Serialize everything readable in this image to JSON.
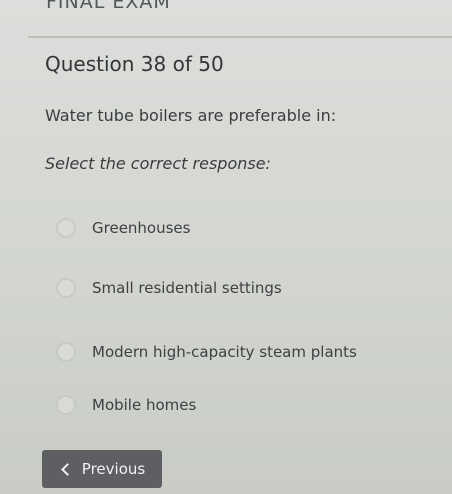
{
  "header": {
    "title": "FINAL EXAM"
  },
  "question": {
    "number_label": "Question 38 of 50",
    "text": "Water tube boilers are preferable in:",
    "instruction": "Select the correct response:"
  },
  "options": [
    {
      "label": "Greenhouses",
      "selected": false
    },
    {
      "label": "Small residential settings",
      "selected": false
    },
    {
      "label": "Modern high-capacity steam plants",
      "selected": false
    },
    {
      "label": "Mobile homes",
      "selected": false
    }
  ],
  "navigation": {
    "previous_label": "Previous",
    "previous_icon": "chevron-left-icon"
  }
}
